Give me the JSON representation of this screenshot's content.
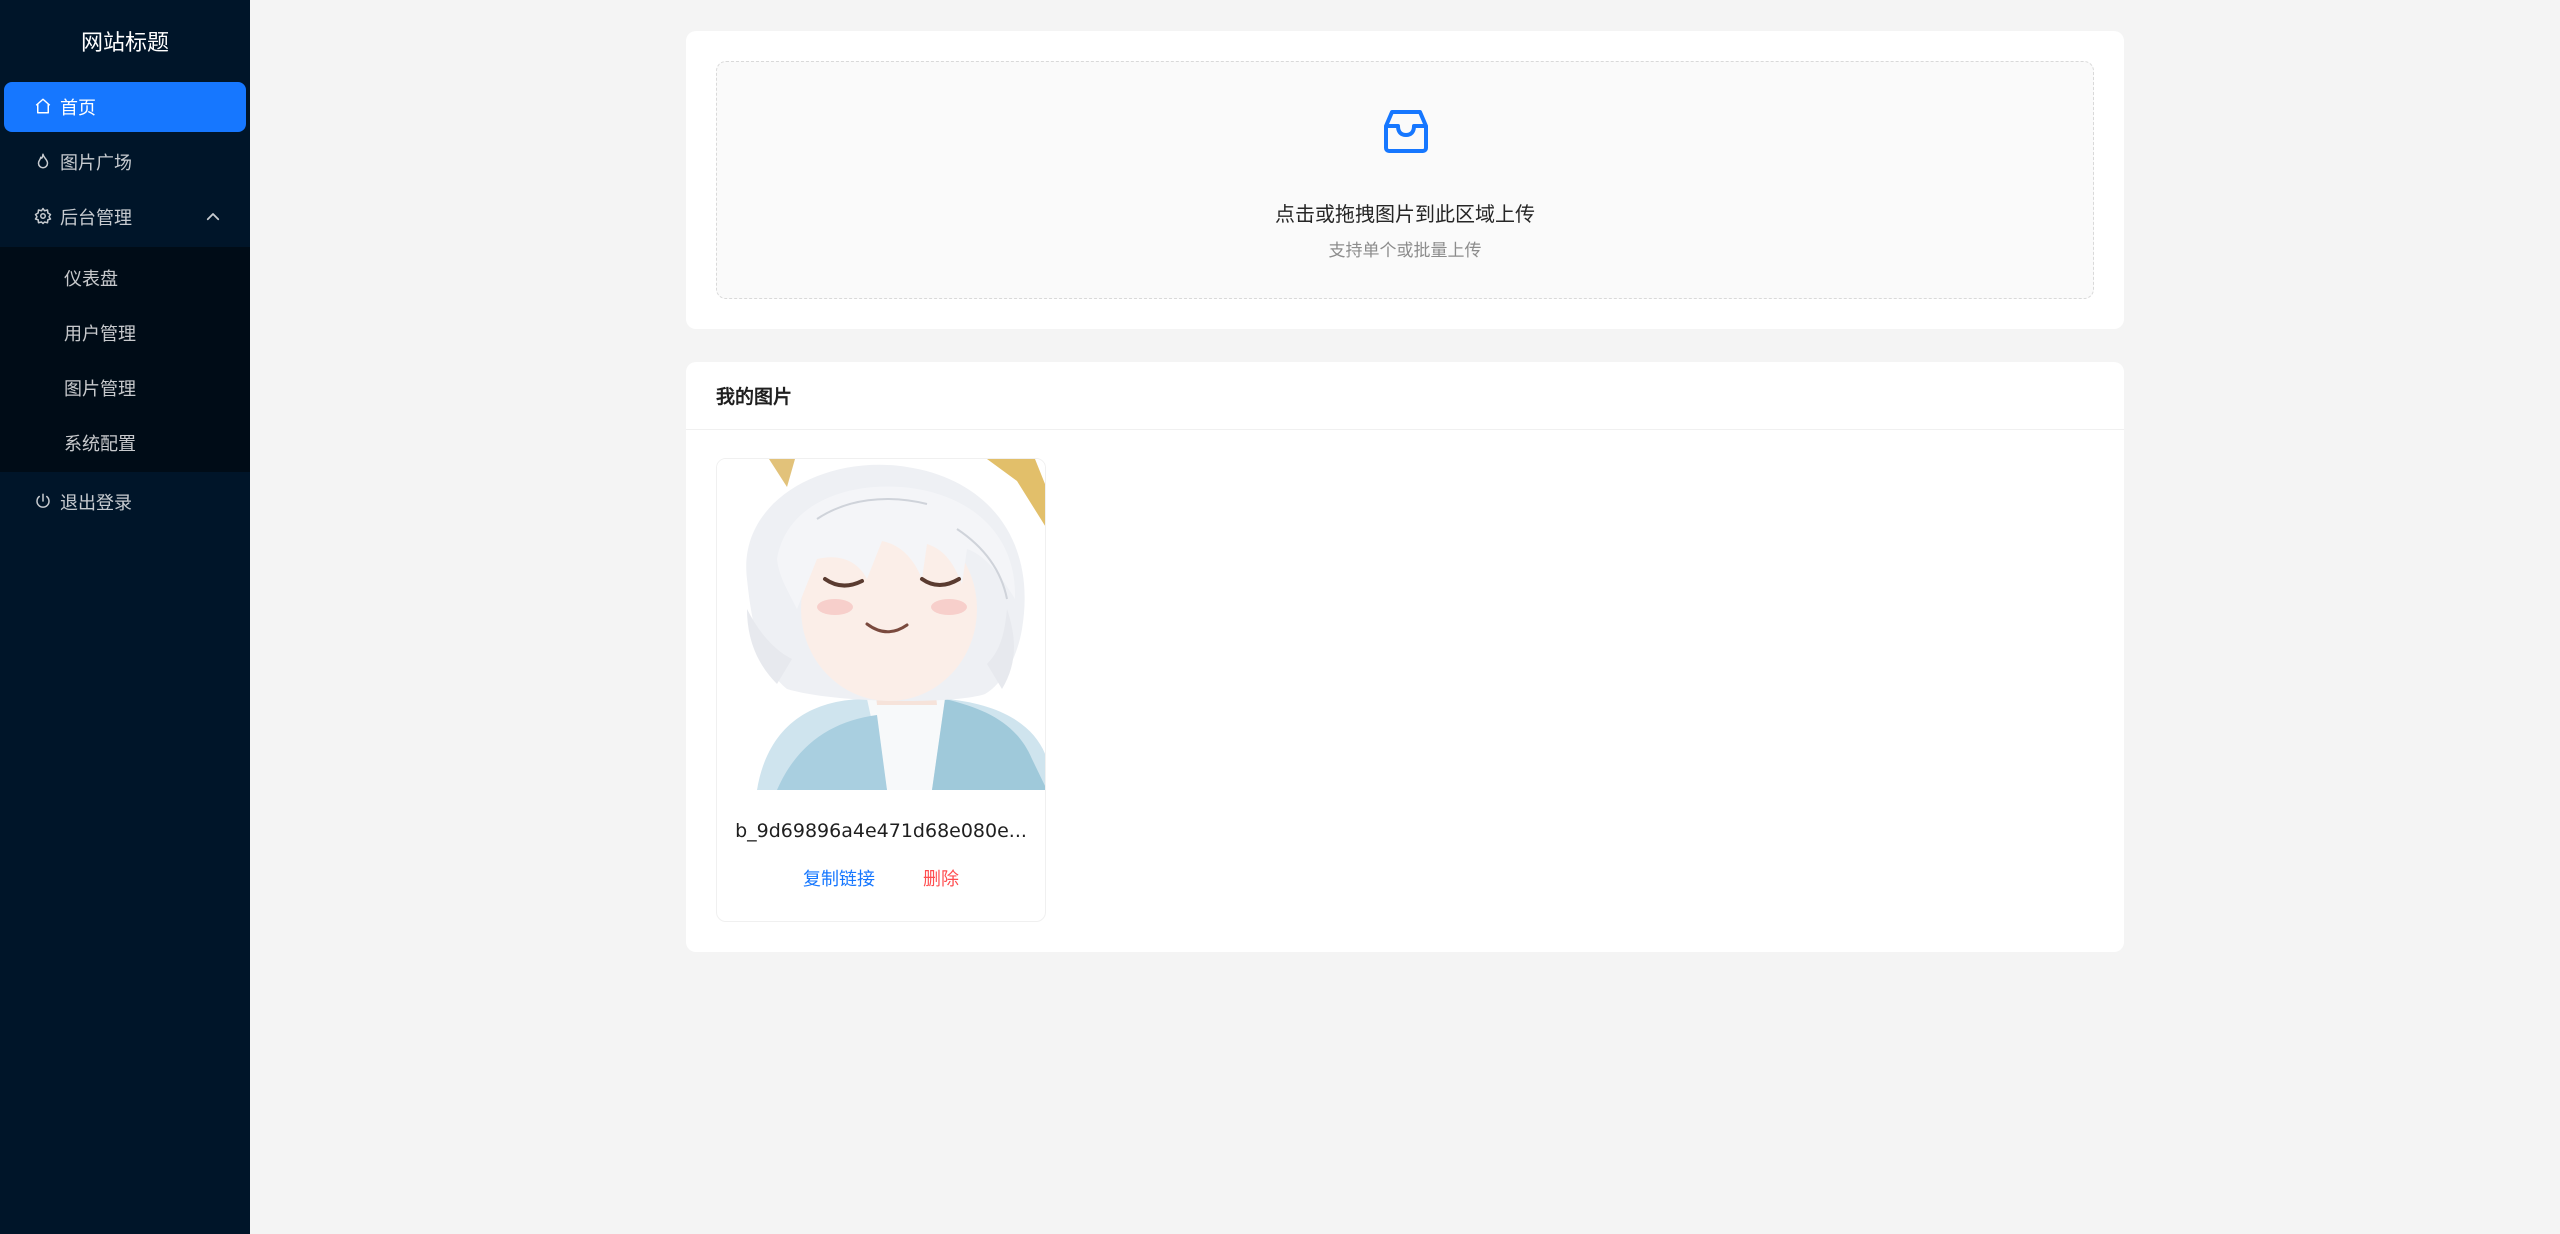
{
  "site": {
    "title": "网站标题"
  },
  "sidebar": {
    "home": "首页",
    "gallery": "图片广场",
    "admin": "后台管理",
    "admin_items": [
      "仪表盘",
      "用户管理",
      "图片管理",
      "系统配置"
    ],
    "logout": "退出登录"
  },
  "upload": {
    "text": "点击或拖拽图片到此区域上传",
    "hint": "支持单个或批量上传"
  },
  "my_images": {
    "title": "我的图片",
    "items": [
      {
        "name": "b_9d69896a4e471d68e080e...",
        "copy": "复制链接",
        "delete": "删除"
      }
    ]
  },
  "colors": {
    "sidebar_bg": "#001529",
    "accent": "#1677ff",
    "danger": "#ff4d4f"
  }
}
